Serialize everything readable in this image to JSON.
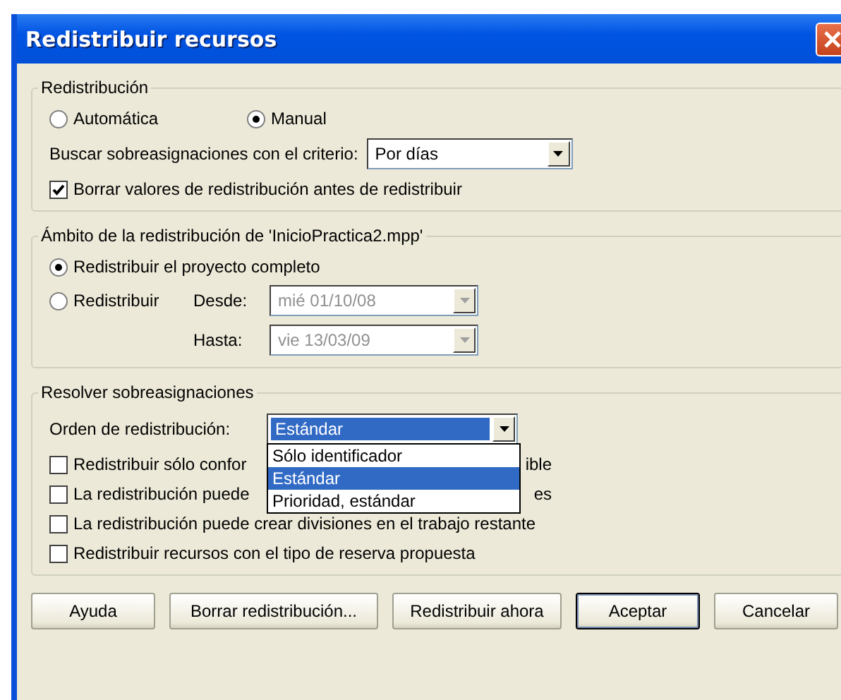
{
  "window": {
    "title": "Redistribuir recursos"
  },
  "redistribucion": {
    "legend": "Redistribución",
    "modes": [
      {
        "label": "Automática",
        "selected": false
      },
      {
        "label": "Manual",
        "selected": true
      }
    ],
    "criterio": {
      "label": "Buscar sobreasignaciones con el criterio:",
      "value": "Por días"
    },
    "borrar_valores": {
      "label": "Borrar valores de redistribución antes de redistribuir",
      "checked": true
    }
  },
  "ambito": {
    "legend": "Ámbito de la redistribución de 'InicioPractica2.mpp'",
    "options": [
      {
        "label": "Redistribuir el proyecto completo",
        "selected": true
      },
      {
        "label": "Redistribuir",
        "selected": false
      }
    ],
    "desde": {
      "label": "Desde:",
      "value": "mié 01/10/08",
      "disabled": true
    },
    "hasta": {
      "label": "Hasta:",
      "value": "vie 13/03/09",
      "disabled": true
    }
  },
  "resolver": {
    "legend": "Resolver sobreasignaciones",
    "orden": {
      "label": "Orden de redistribución:",
      "value": "Estándar",
      "expanded": true,
      "options": [
        {
          "label": "Sólo identificador",
          "selected": false
        },
        {
          "label": "Estándar",
          "selected": true
        },
        {
          "label": "Prioridad, estándar",
          "selected": false
        }
      ]
    },
    "options": [
      {
        "label": "Redistribuir sólo confor",
        "label_end": "ible",
        "checked": false
      },
      {
        "label": "La redistribución puede",
        "label_end": "es",
        "checked": false
      },
      {
        "label": "La redistribución puede crear divisiones en el trabajo restante",
        "checked": false
      },
      {
        "label": "Redistribuir recursos con el tipo de reserva propuesta",
        "checked": false
      }
    ]
  },
  "buttons": [
    {
      "label": "Ayuda",
      "default": false
    },
    {
      "label": "Borrar redistribución...",
      "default": false
    },
    {
      "label": "Redistribuir ahora",
      "default": false
    },
    {
      "label": "Aceptar",
      "default": true
    },
    {
      "label": "Cancelar",
      "default": false
    }
  ]
}
